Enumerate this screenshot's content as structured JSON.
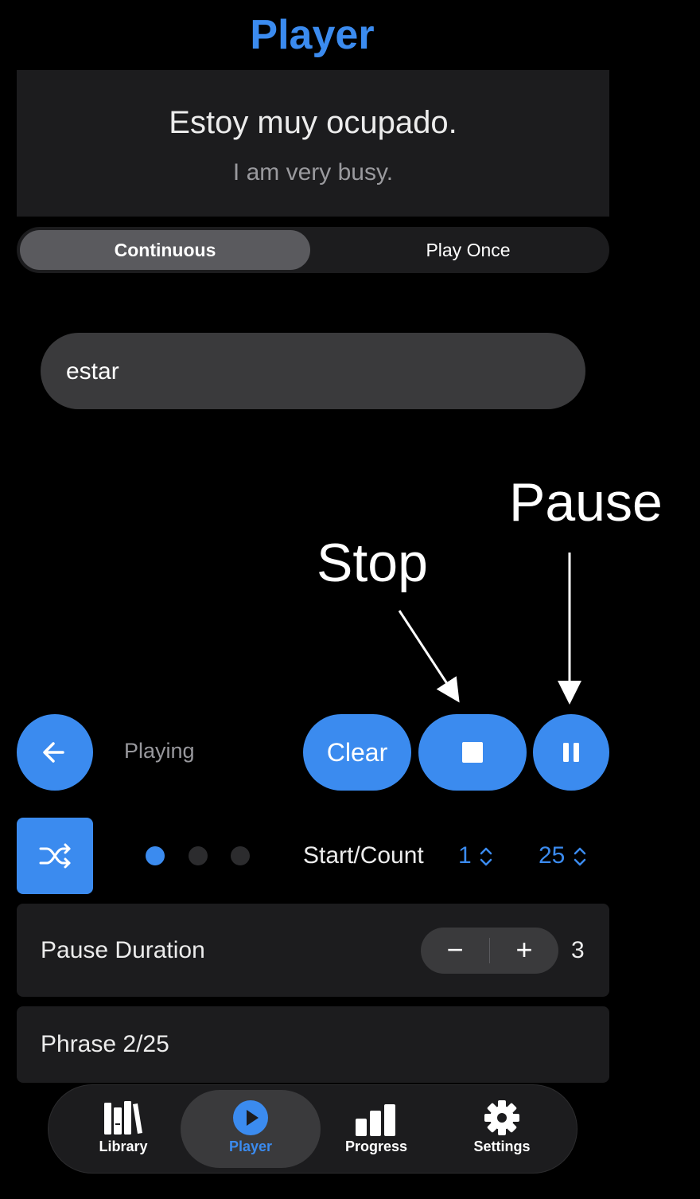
{
  "header": {
    "title": "Player"
  },
  "phrase_card": {
    "spanish": "Estoy muy ocupado.",
    "english": "I am very busy."
  },
  "mode_toggle": {
    "continuous": "Continuous",
    "play_once": "Play Once",
    "selected": "Continuous"
  },
  "search": {
    "value": "estar"
  },
  "annotations": {
    "stop": "Stop",
    "pause": "Pause"
  },
  "controls": {
    "status": "Playing",
    "clear_label": "Clear",
    "back_icon": "arrow-left-icon",
    "stop_icon": "stop-icon",
    "pause_icon": "pause-icon"
  },
  "options": {
    "shuffle_icon": "shuffle-icon",
    "page_dots": {
      "count": 3,
      "active": 1
    },
    "start_count_label": "Start/Count",
    "start_value": "1",
    "count_value": "25"
  },
  "pause_duration": {
    "label": "Pause Duration",
    "value": "3",
    "minus": "−",
    "plus": "+"
  },
  "progress": {
    "label": "Phrase 2/25"
  },
  "tabs": [
    {
      "label": "Library",
      "icon": "library-icon",
      "active": false
    },
    {
      "label": "Player",
      "icon": "play-circle-icon",
      "active": true
    },
    {
      "label": "Progress",
      "icon": "bar-chart-icon",
      "active": false
    },
    {
      "label": "Settings",
      "icon": "gear-icon",
      "active": false
    }
  ],
  "colors": {
    "accent": "#3b8bef",
    "card": "#1c1c1e",
    "field": "#3a3a3c"
  }
}
